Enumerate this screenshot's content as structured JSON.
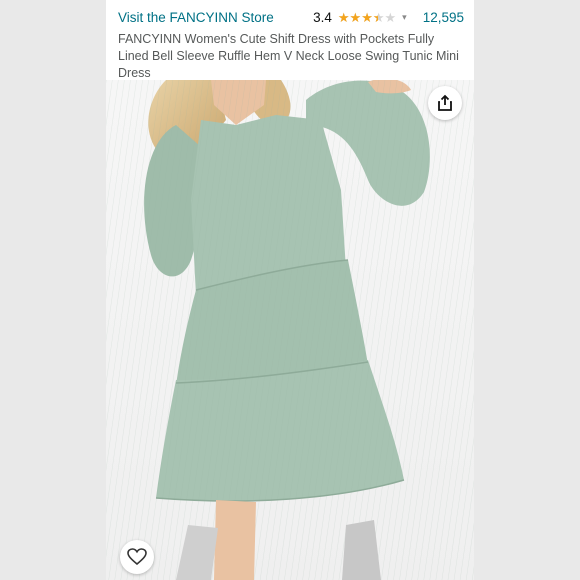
{
  "header": {
    "store_link": "Visit the FANCYINN Store",
    "rating": {
      "value": "3.4",
      "stars_out_of_5": 3.4,
      "count": "12,595",
      "star_color": "#f4a41c"
    }
  },
  "product": {
    "title": "FANCYINN Women's Cute Shift Dress with Pockets Fully Lined Bell Sleeve Ruffle Hem V Neck Loose Swing Tunic Mini Dress",
    "dress_color": "#a7c3b2"
  },
  "icons": {
    "share": "share-icon",
    "wishlist": "heart-icon"
  },
  "colors": {
    "link": "#007185",
    "text_secondary": "#565959",
    "background": "#e9e9e9"
  }
}
